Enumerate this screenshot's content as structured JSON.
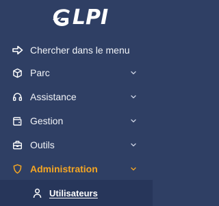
{
  "app": {
    "logo_text": "LPI"
  },
  "search": {
    "label": "Chercher dans le menu",
    "icon": "arrow-right-to-bracket-icon"
  },
  "menu": {
    "items": [
      {
        "label": "Parc",
        "icon": "cube-icon"
      },
      {
        "label": "Assistance",
        "icon": "headset-icon"
      },
      {
        "label": "Gestion",
        "icon": "wallet-icon"
      },
      {
        "label": "Outils",
        "icon": "briefcase-icon"
      },
      {
        "label": "Administration",
        "icon": "shield-icon",
        "active": true
      }
    ]
  },
  "submenu": {
    "items": [
      {
        "label": "Utilisateurs",
        "icon": "user-icon"
      }
    ]
  },
  "colors": {
    "sidebar_bg": "#2f3f64",
    "submenu_bg": "#27365a",
    "active": "#f5a623",
    "text": "#f2f4f8"
  }
}
